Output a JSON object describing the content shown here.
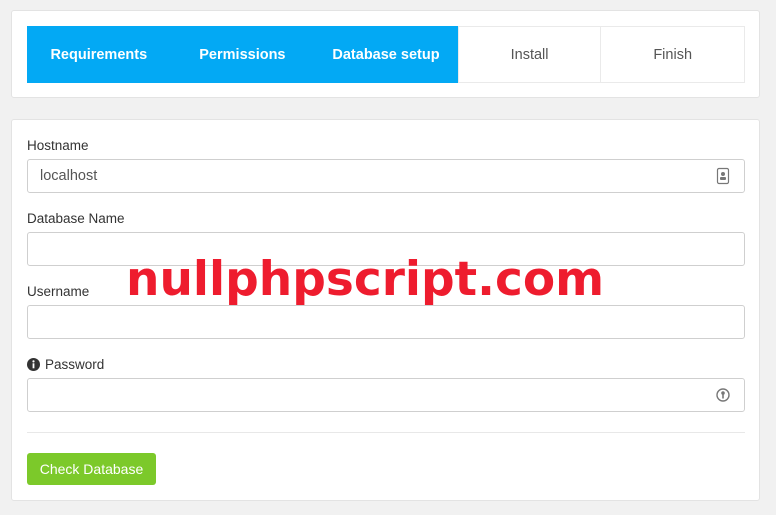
{
  "steps": [
    {
      "label": "Requirements",
      "state": "done"
    },
    {
      "label": "Permissions",
      "state": "done"
    },
    {
      "label": "Database setup",
      "state": "done"
    },
    {
      "label": "Install",
      "state": "todo"
    },
    {
      "label": "Finish",
      "state": "todo"
    }
  ],
  "form": {
    "hostname": {
      "label": "Hostname",
      "value": "localhost",
      "icon": "contact-card-icon"
    },
    "database_name": {
      "label": "Database Name",
      "value": ""
    },
    "username": {
      "label": "Username",
      "value": ""
    },
    "password": {
      "label": "Password",
      "value": "",
      "label_icon": "info-icon",
      "icon": "key-icon"
    },
    "submit_label": "Check Database"
  },
  "watermark": "nullphpscript.com",
  "colors": {
    "step_active": "#03a9f4",
    "button": "#7cc92a",
    "watermark": "#ee1c2e"
  }
}
